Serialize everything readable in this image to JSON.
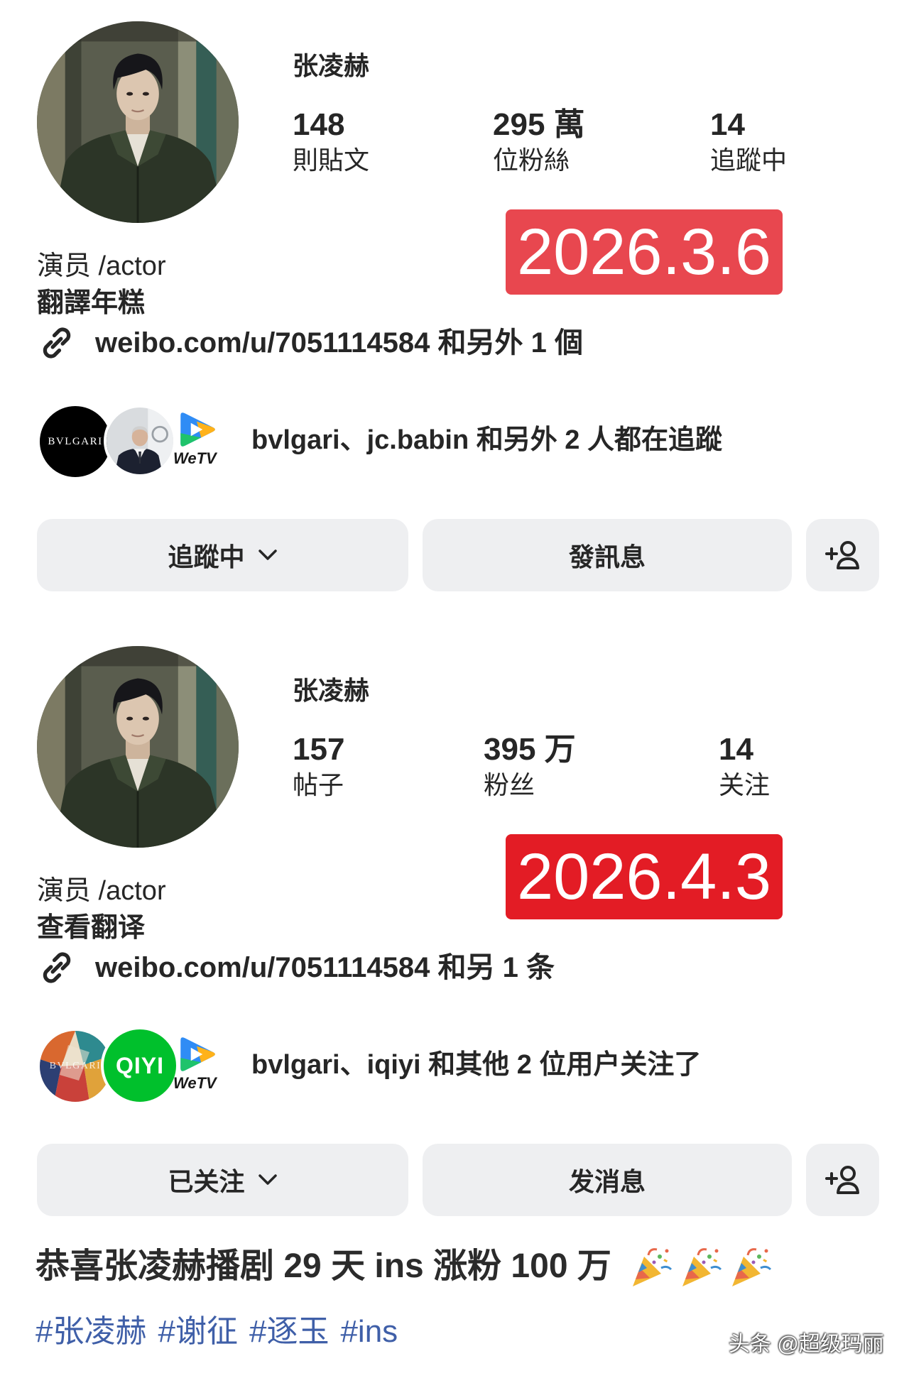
{
  "profiles": [
    {
      "username": "张凌赫",
      "stats": [
        {
          "value": "148",
          "label": "則貼文"
        },
        {
          "value": "295 萬",
          "label": "位粉絲"
        },
        {
          "value": "14",
          "label": "追蹤中"
        }
      ],
      "date_stamp": "2026.3.6",
      "date_stamp_color": "#e8474f",
      "bio": "演员 /actor",
      "translate_label": "翻譯年糕",
      "link_icon": "link-icon",
      "link_text": "weibo.com/u/7051114584 和另外 1 個",
      "followed_by": {
        "avatars": [
          {
            "icon": "bvlgari-logo",
            "text": "BVLGARI",
            "color": "#000000"
          },
          {
            "icon": "jc-babin-avatar"
          },
          {
            "icon": "wetv-logo",
            "text": "WeTV"
          }
        ],
        "text": "bvlgari、jc.babin 和另外 2 人都在追蹤"
      },
      "buttons": {
        "following": "追蹤中",
        "following_icon": "chevron-down-icon",
        "message": "發訊息",
        "suggest_icon": "add-person-icon"
      }
    },
    {
      "username": "张凌赫",
      "stats": [
        {
          "value": "157",
          "label": "帖子"
        },
        {
          "value": "395 万",
          "label": "粉丝"
        },
        {
          "value": "14",
          "label": "关注"
        }
      ],
      "date_stamp": "2026.4.3",
      "date_stamp_color": "#e31c25",
      "bio": "演员 /actor",
      "translate_label": "查看翻译",
      "link_icon": "link-icon",
      "link_text": "weibo.com/u/7051114584 和另 1 条",
      "followed_by": {
        "avatars": [
          {
            "icon": "bvlgari-logo",
            "text": "BVLGARI"
          },
          {
            "icon": "iqiyi-logo",
            "text": "QIYI",
            "color": "#00c02c"
          },
          {
            "icon": "wetv-logo",
            "text": "WeTV"
          }
        ],
        "text": "bvlgari、iqiyi 和其他 2 位用户关注了"
      },
      "buttons": {
        "following": "已关注",
        "following_icon": "chevron-down-icon",
        "message": "发消息",
        "suggest_icon": "add-person-icon"
      }
    }
  ],
  "caption": {
    "text": "恭喜张凌赫播剧 29 天 ins 涨粉 100 万",
    "emoji_icons": [
      "party-popper-icon",
      "party-popper-icon",
      "party-popper-icon"
    ]
  },
  "hashtags": [
    "#张凌赫",
    "#谢征",
    "#逐玉",
    "#ins"
  ],
  "watermark": "头条 @超级玛丽",
  "colors": {
    "button_bg": "#eeeff1",
    "hashtag": "#3f5fa8",
    "text": "#262626"
  }
}
